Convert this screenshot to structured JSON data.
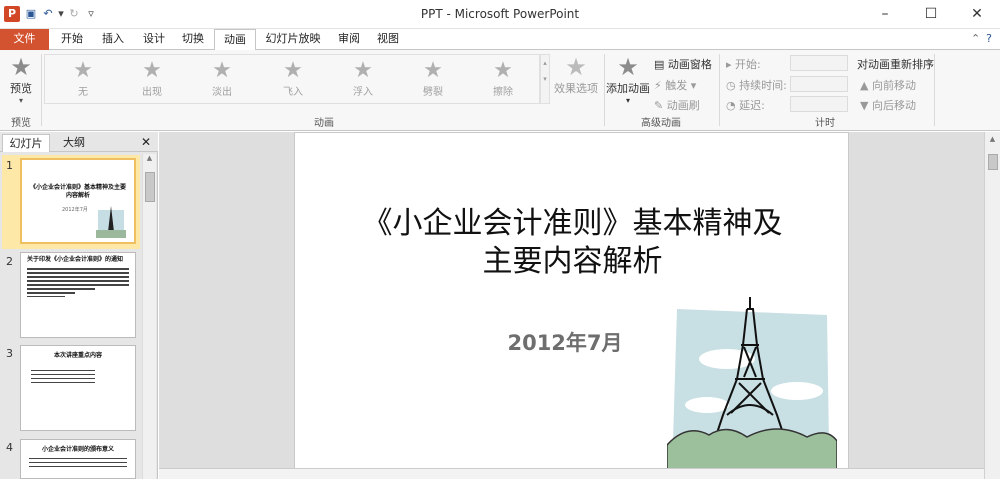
{
  "window": {
    "title": "PPT - Microsoft PowerPoint",
    "app_icon": "P"
  },
  "qat": [
    "save-icon",
    "undo-icon",
    "redo-icon",
    "customize-icon"
  ],
  "tabs": {
    "file": "文件",
    "items": [
      "开始",
      "插入",
      "设计",
      "切换",
      "动画",
      "幻灯片放映",
      "审阅",
      "视图"
    ],
    "active": "动画"
  },
  "ribbon": {
    "preview": {
      "label": "预览",
      "group": "预览"
    },
    "gallery": [
      "无",
      "出现",
      "淡出",
      "飞入",
      "浮入",
      "劈裂",
      "擦除"
    ],
    "effect_options": "效果选项",
    "animation_group": "动画",
    "add_animation": "添加动画",
    "animation_pane": "动画窗格",
    "trigger": "触发",
    "animation_painter": "动画刷",
    "advanced_group": "高级动画",
    "start": "开始:",
    "duration": "持续时间:",
    "delay": "延迟:",
    "timing_group": "计时",
    "reorder": "对动画重新排序",
    "move_earlier": "向前移动",
    "move_later": "向后移动"
  },
  "pane": {
    "tab_slides": "幻灯片",
    "tab_outline": "大纲",
    "close": "✕"
  },
  "thumbnails": [
    {
      "num": "1",
      "title": "《小企业会计准则》基本精神及主要内容解析",
      "sub": "2012年7月"
    },
    {
      "num": "2",
      "title": "关于印发《小企业会计准则》的通知"
    },
    {
      "num": "3",
      "title": "本次讲座重点内容"
    },
    {
      "num": "4",
      "title": "小企业会计准则的颁布意义"
    }
  ],
  "slide": {
    "title_line1": "《小企业会计准则》基本精神及",
    "title_line2": "主要内容解析",
    "date": "2012年7月"
  }
}
